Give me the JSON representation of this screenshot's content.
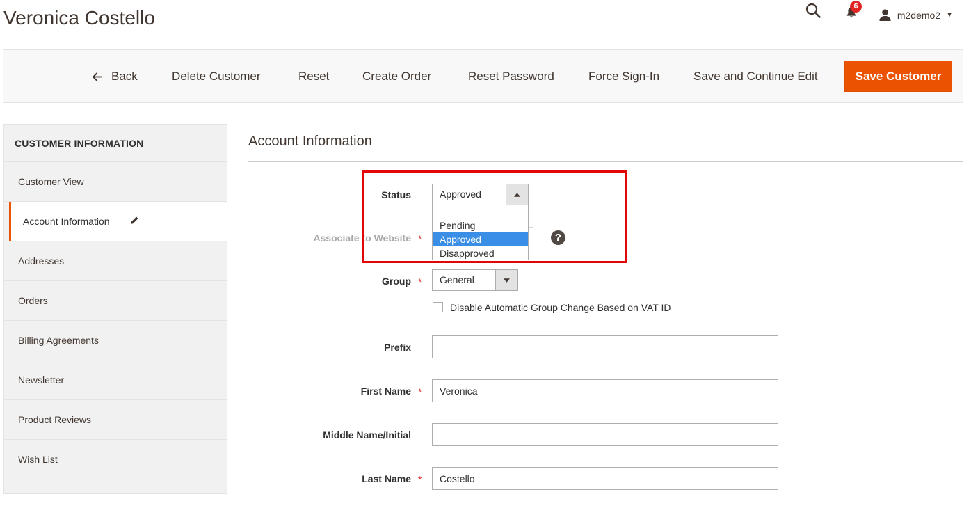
{
  "page": {
    "title": "Veronica Costello"
  },
  "header": {
    "notifications_count": "6",
    "username": "m2demo2"
  },
  "toolbar": {
    "back_label": "Back",
    "delete_label": "Delete Customer",
    "reset_label": "Reset",
    "create_order_label": "Create Order",
    "reset_password_label": "Reset Password",
    "force_signin_label": "Force Sign-In",
    "save_continue_label": "Save and Continue Edit",
    "save_customer_label": "Save Customer"
  },
  "sidebar": {
    "title": "CUSTOMER INFORMATION",
    "items": [
      {
        "label": "Customer View"
      },
      {
        "label": "Account Information"
      },
      {
        "label": "Addresses"
      },
      {
        "label": "Orders"
      },
      {
        "label": "Billing Agreements"
      },
      {
        "label": "Newsletter"
      },
      {
        "label": "Product Reviews"
      },
      {
        "label": "Wish List"
      }
    ]
  },
  "form": {
    "section_title": "Account Information",
    "status": {
      "label": "Status",
      "value": "Approved",
      "options": [
        "Pending",
        "Approved",
        "Disapproved"
      ]
    },
    "website": {
      "label": "Associate to Website",
      "required_mark": "*"
    },
    "group": {
      "label": "Group",
      "value": "General",
      "required_mark": "*"
    },
    "vat_checkbox_label": "Disable Automatic Group Change Based on VAT ID",
    "prefix": {
      "label": "Prefix",
      "value": ""
    },
    "first_name": {
      "label": "First Name",
      "value": "Veronica",
      "required_mark": "*"
    },
    "middle_name": {
      "label": "Middle Name/Initial",
      "value": ""
    },
    "last_name": {
      "label": "Last Name",
      "value": "Costello",
      "required_mark": "*"
    }
  },
  "colors": {
    "accent": "#eb5202",
    "highlight": "#e20606",
    "selected_option": "#3a8ee6"
  },
  "icons": [
    "search-icon",
    "bell-icon",
    "user-icon",
    "arrow-left-icon",
    "pencil-icon",
    "help-icon",
    "chevron-up-icon",
    "chevron-down-icon"
  ]
}
